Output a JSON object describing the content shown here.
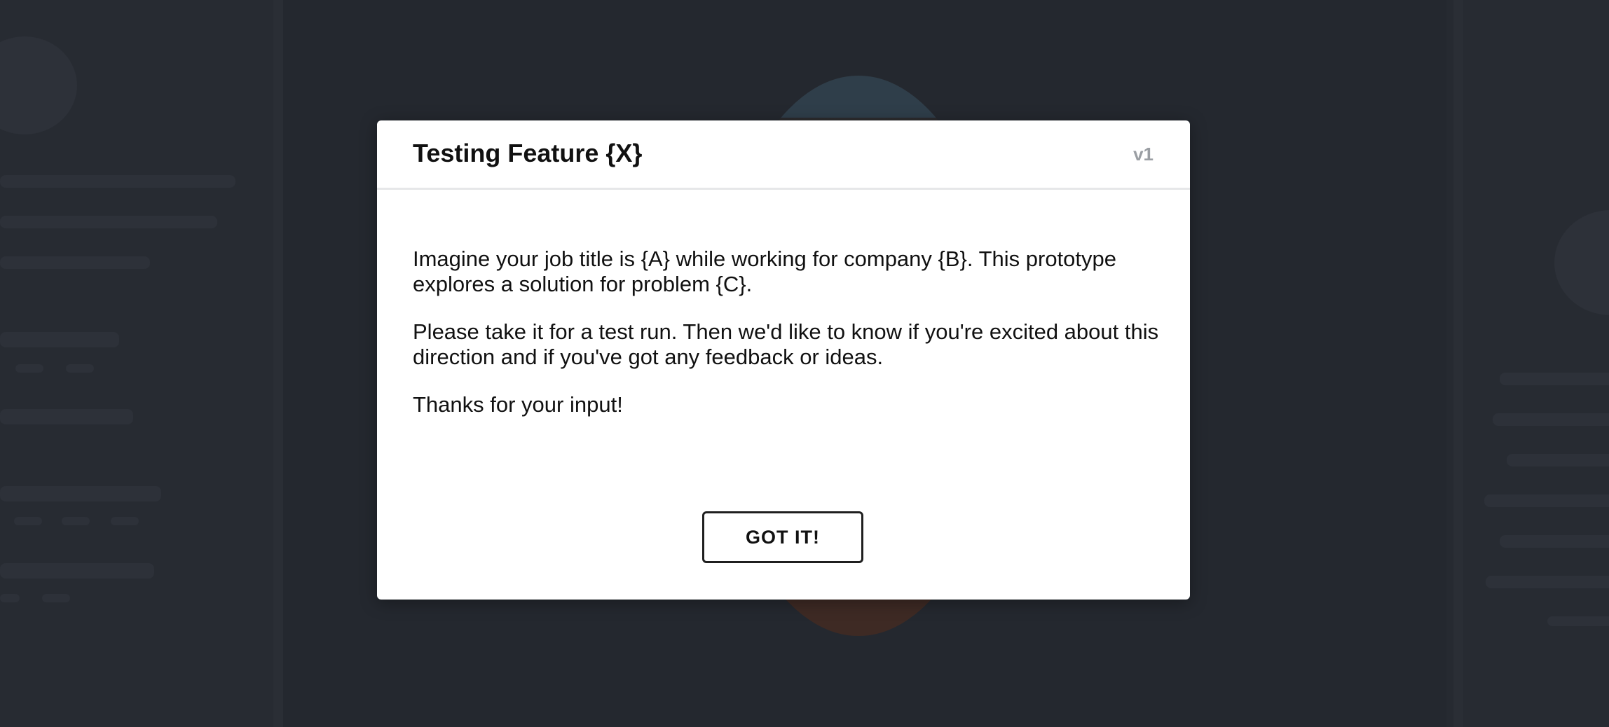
{
  "modal": {
    "title": "Testing Feature {X}",
    "version": "v1",
    "paragraphs": [
      "Imagine your job title is {A} while working for company {B}. This prototype explores a solution for problem {C}.",
      "Please take it for a test run. Then we'd like to know if you're excited about this direction and if you've got any feedback or ideas.",
      "Thanks for your input!"
    ],
    "button_label": "GOT IT!"
  },
  "colors": {
    "overlay_background": "#23272e",
    "modal_background": "#ffffff",
    "version_text": "#9a9ea3",
    "button_border": "#1f1f1f"
  }
}
